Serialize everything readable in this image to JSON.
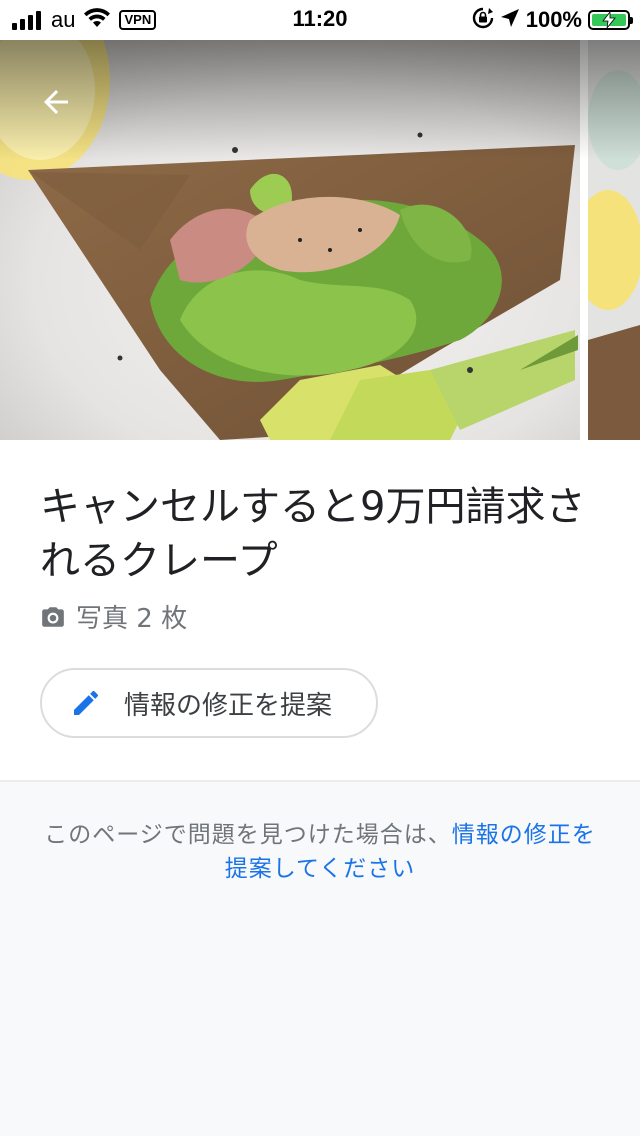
{
  "status_bar": {
    "carrier": "au",
    "vpn_label": "VPN",
    "time": "11:20",
    "battery_percent_text": "100%",
    "battery_level": 1.0
  },
  "header": {
    "back_icon": "arrow-left-icon"
  },
  "place": {
    "title": "キャンセルすると9万円請求されるクレープ",
    "photo_count_label": "写真 2 枚"
  },
  "actions": {
    "suggest_edit_label": "情報の修正を提案"
  },
  "footer": {
    "prefix_text": "このページで問題を見つけた場合は、",
    "link_text": "情報の修正を提案してください"
  },
  "colors": {
    "link": "#1a73e8",
    "edit_icon": "#1a73e8",
    "battery_charging": "#34c759"
  }
}
